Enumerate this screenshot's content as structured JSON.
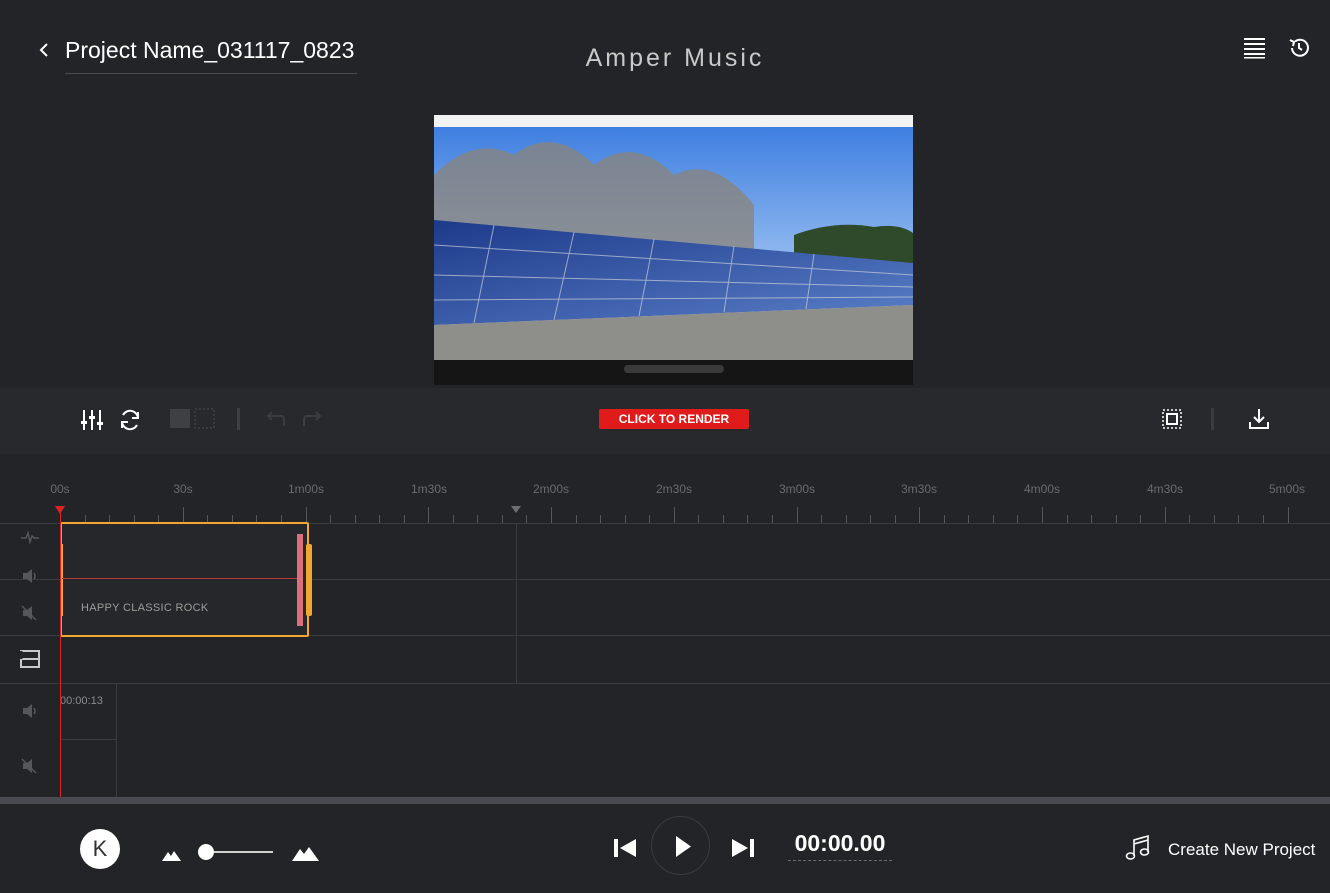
{
  "header": {
    "project_name": "Project Name_031117_0823",
    "app_title": "Amper Music"
  },
  "toolbar": {
    "render_label": "CLICK TO RENDER"
  },
  "ruler": {
    "labels": [
      "00s",
      "30s",
      "1m00s",
      "1m30s",
      "2m00s",
      "2m30s",
      "3m00s",
      "3m30s",
      "4m00s",
      "4m30s",
      "5m00s"
    ]
  },
  "tracks": {
    "music_clip_label": "HAPPY CLASSIC ROCK",
    "video_clip_time": "00:00:13"
  },
  "bottom": {
    "avatar_initial": "K",
    "time": "00:00.00",
    "create_label": "Create New Project"
  },
  "colors": {
    "accent_red": "#e01b1b",
    "clip_border": "#f0a630",
    "background": "#232427"
  },
  "icons": [
    "back-icon",
    "menu-list-icon",
    "history-icon",
    "mixer-icon",
    "refresh-icon",
    "undo-icon",
    "redo-icon",
    "fit-icon",
    "download-icon",
    "waveform-icon",
    "volume-icon",
    "mute-icon",
    "video-track-icon",
    "mountain-small-icon",
    "mountain-large-icon",
    "skip-previous-icon",
    "play-icon",
    "skip-next-icon",
    "music-note-icon"
  ]
}
